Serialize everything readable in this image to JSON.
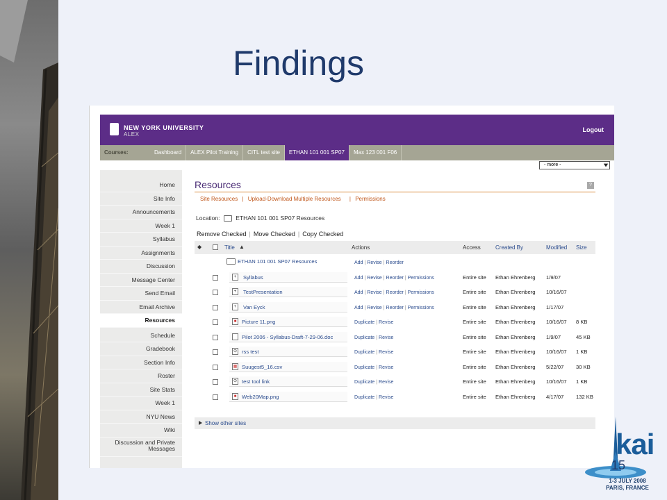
{
  "slide": {
    "title": "Findings",
    "page_number": "15",
    "logo_text": "kai",
    "logo_date_line1": "1-3 JULY 2008",
    "logo_date_line2": "PARIS, FRANCE"
  },
  "header": {
    "org_name": "NEW YORK UNIVERSITY",
    "org_sub": "ALEX",
    "logout_label": "Logout"
  },
  "coursebar": {
    "label": "Courses:",
    "courses": [
      "Dashboard",
      "ALEX Pilot Training",
      "CITL test site",
      "ETHAN 101 001 SP07",
      "Max 123 001 F06"
    ],
    "active_index": 3,
    "more_select_value": "- more -"
  },
  "sidebar": {
    "items": [
      "Home",
      "Site Info",
      "Announcements",
      "Week 1",
      "Syllabus",
      "Assignments",
      "Discussion",
      "Message Center",
      "Send Email",
      "Email Archive",
      "Resources",
      "Schedule",
      "Gradebook",
      "Section Info",
      "Roster",
      "Site Stats",
      "Week 1",
      "NYU News",
      "Wiki",
      "Discussion and Private Messages"
    ],
    "active_index": 10
  },
  "main": {
    "title": "Resources",
    "help_label": "?",
    "subnav": [
      "Site Resources",
      "|",
      "Upload-Download Multiple Resources",
      "|",
      "Permissions"
    ],
    "location_label": "Location:",
    "location_value": "ETHAN 101 001 SP07 Resources",
    "batch_actions": [
      "Remove Checked",
      "Move Checked",
      "Copy Checked"
    ],
    "columns": {
      "title": "Title",
      "actions": "Actions",
      "access": "Access",
      "created_by": "Created By",
      "modified": "Modified",
      "size": "Size"
    },
    "root_row": {
      "title": "ETHAN 101 001 SP07 Resources",
      "actions": [
        "Add",
        "Revise",
        "Reorder"
      ]
    },
    "rows": [
      {
        "title": "Syllabus",
        "icon": "folder-plus-icon",
        "actions": [
          "Add",
          "Revise",
          "Reorder",
          "Permissions"
        ],
        "access": "Entire site",
        "created_by": "Ethan Ehrenberg",
        "modified": "1/9/07",
        "size": ""
      },
      {
        "title": "TestPresentation",
        "icon": "folder-plus-icon",
        "actions": [
          "Add",
          "Revise",
          "Reorder",
          "Permissions"
        ],
        "access": "Entire site",
        "created_by": "Ethan Ehrenberg",
        "modified": "10/16/07",
        "size": ""
      },
      {
        "title": "Van Eyck",
        "icon": "folder-plus-icon",
        "actions": [
          "Add",
          "Revise",
          "Reorder",
          "Permissions"
        ],
        "access": "Entire site",
        "created_by": "Ethan Ehrenberg",
        "modified": "1/17/07",
        "size": ""
      },
      {
        "title": "Picture 11.png",
        "icon": "image-file-icon",
        "actions": [
          "Duplicate",
          "Revise"
        ],
        "access": "Entire site",
        "created_by": "Ethan Ehrenberg",
        "modified": "10/16/07",
        "size": "8 KB"
      },
      {
        "title": "Pilot 2006 - Syllabus-Draft-7-29-06.doc",
        "icon": "document-file-icon",
        "actions": [
          "Duplicate",
          "Revise"
        ],
        "access": "Entire site",
        "created_by": "Ethan Ehrenberg",
        "modified": "1/9/07",
        "size": "45 KB"
      },
      {
        "title": "rss test",
        "icon": "link-file-icon",
        "actions": [
          "Duplicate",
          "Revise"
        ],
        "access": "Entire site",
        "created_by": "Ethan Ehrenberg",
        "modified": "10/16/07",
        "size": "1 KB"
      },
      {
        "title": "Suugest5_16.csv",
        "icon": "spreadsheet-file-icon",
        "actions": [
          "Duplicate",
          "Revise"
        ],
        "access": "Entire site",
        "created_by": "Ethan Ehrenberg",
        "modified": "5/22/07",
        "size": "30 KB"
      },
      {
        "title": "test tool link",
        "icon": "link-file-icon",
        "actions": [
          "Duplicate",
          "Revise"
        ],
        "access": "Entire site",
        "created_by": "Ethan Ehrenberg",
        "modified": "10/16/07",
        "size": "1 KB"
      },
      {
        "title": "Web20Map.png",
        "icon": "image-file-icon",
        "actions": [
          "Duplicate",
          "Revise"
        ],
        "access": "Entire site",
        "created_by": "Ethan Ehrenberg",
        "modified": "4/17/07",
        "size": "132 KB"
      }
    ],
    "footer_link": "Show other sites"
  },
  "colors": {
    "brand_purple": "#5c2d87",
    "course_bar": "#a5a594",
    "title_blue": "#1f3a6b",
    "link_orange": "#c0571b"
  }
}
